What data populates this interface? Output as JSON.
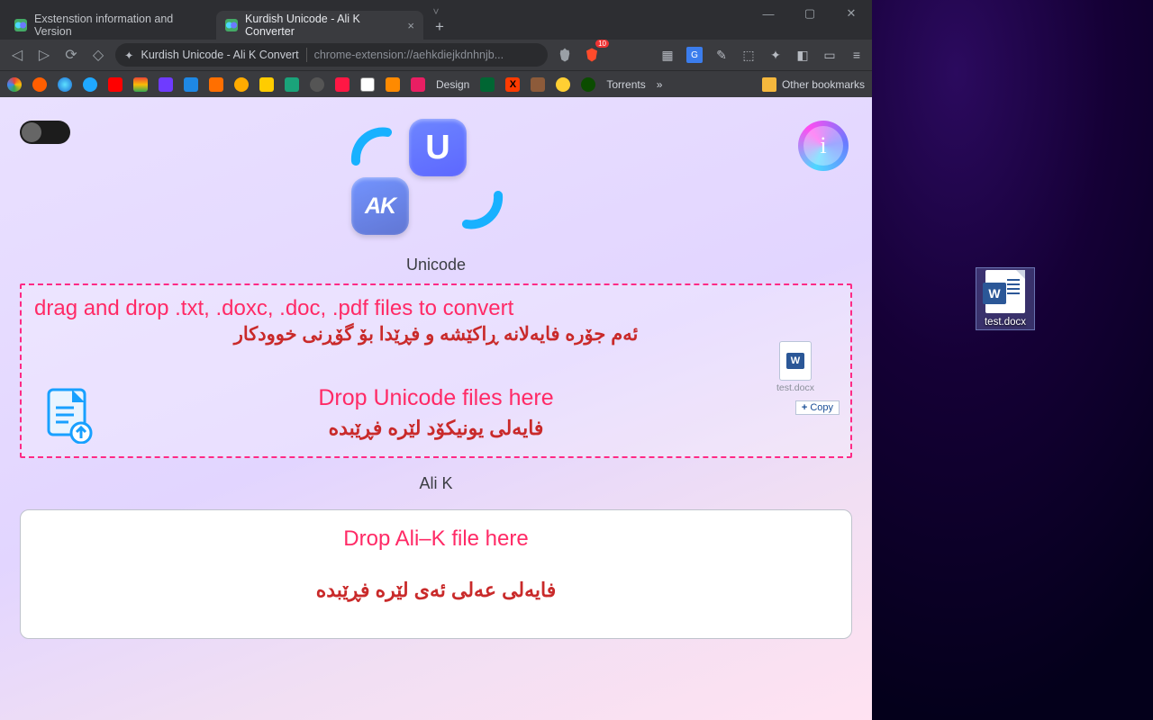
{
  "window": {
    "chevron": "˅",
    "min": "—",
    "max": "▢",
    "close": "✕"
  },
  "tabs": {
    "t0": "Exstenstion information and Version",
    "t1": "Kurdish Unicode - Ali K Converter",
    "t1_close": "×",
    "plus": "+"
  },
  "addr": {
    "back": "◁",
    "fwd": "▷",
    "reload": "⟳",
    "bookmark": "◇",
    "title": "Kurdish Unicode - Ali K Convert",
    "url": "chrome-extension://aehkdiejkdnhnjb...",
    "brave_count": "10"
  },
  "bookmarks": {
    "design": "Design",
    "torrents": "Torrents",
    "more": "»",
    "other": "Other bookmarks"
  },
  "page": {
    "u": "U",
    "ak": "AK",
    "info": "i",
    "unicode_label": "Unicode",
    "alik_label": "Ali K",
    "dz_line1": "drag and drop .txt, .doxc, .doc, .pdf files to convert",
    "dz_line2": "ئەم جۆرە فایەلانە ڕاکێشە و فڕێدا بۆ گۆڕنی خوودکار",
    "dz_drop_en": "Drop Unicode files here",
    "dz_drop_ku": "فایەلی یونیکۆد لێرە فڕێبدە",
    "z2_en": "Drop Ali–K file here",
    "z2_ku": "فایەلی عەلی ئەی لێرە فڕێبدە",
    "ghost_name": "test.docx",
    "copy_tip": "Copy",
    "w": "W"
  },
  "desktop": {
    "file": "test.docx",
    "w": "W"
  }
}
